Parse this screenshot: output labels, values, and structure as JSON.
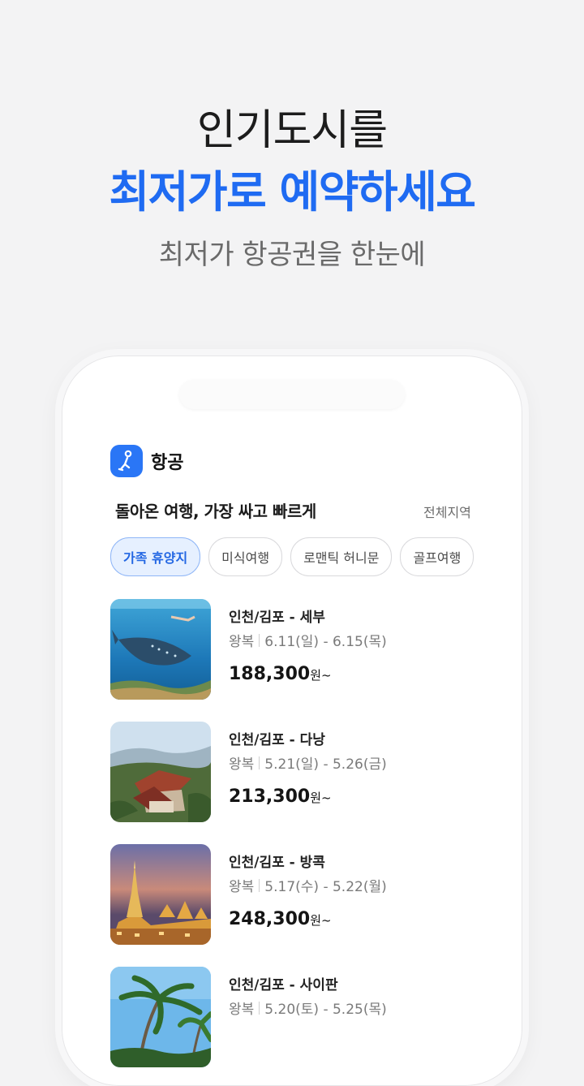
{
  "hero": {
    "line1": "인기도시를",
    "line2": "최저가로 예약하세요",
    "subtitle": "최저가 항공권을 한눈에"
  },
  "app": {
    "title": "항공",
    "logo_icon": "person-running-icon",
    "accent_color": "#2a76f6"
  },
  "section": {
    "title": "돌아온 여행, 가장 싸고 빠르게",
    "link": "전체지역"
  },
  "chips": [
    {
      "label": "가족 휴양지",
      "active": true
    },
    {
      "label": "미식여행",
      "active": false
    },
    {
      "label": "로맨틱 허니문",
      "active": false
    },
    {
      "label": "골프여행",
      "active": false
    }
  ],
  "deals": [
    {
      "route": "인천/김포 - 세부",
      "trip": "왕복",
      "dates": "6.11(일) - 6.15(목)",
      "price": "188,300",
      "unit": "원~",
      "image": "whale-shark-underwater"
    },
    {
      "route": "인천/김포 - 다낭",
      "trip": "왕복",
      "dates": "5.21(일) - 5.26(금)",
      "price": "213,300",
      "unit": "원~",
      "image": "danang-temple-hills"
    },
    {
      "route": "인천/김포 - 방콕",
      "trip": "왕복",
      "dates": "5.17(수) - 5.22(월)",
      "price": "248,300",
      "unit": "원~",
      "image": "bangkok-temple-dusk"
    },
    {
      "route": "인천/김포 - 사이판",
      "trip": "왕복",
      "dates": "5.20(토) - 5.25(목)",
      "price": "",
      "unit": "",
      "image": "saipan-palm-trees"
    }
  ]
}
